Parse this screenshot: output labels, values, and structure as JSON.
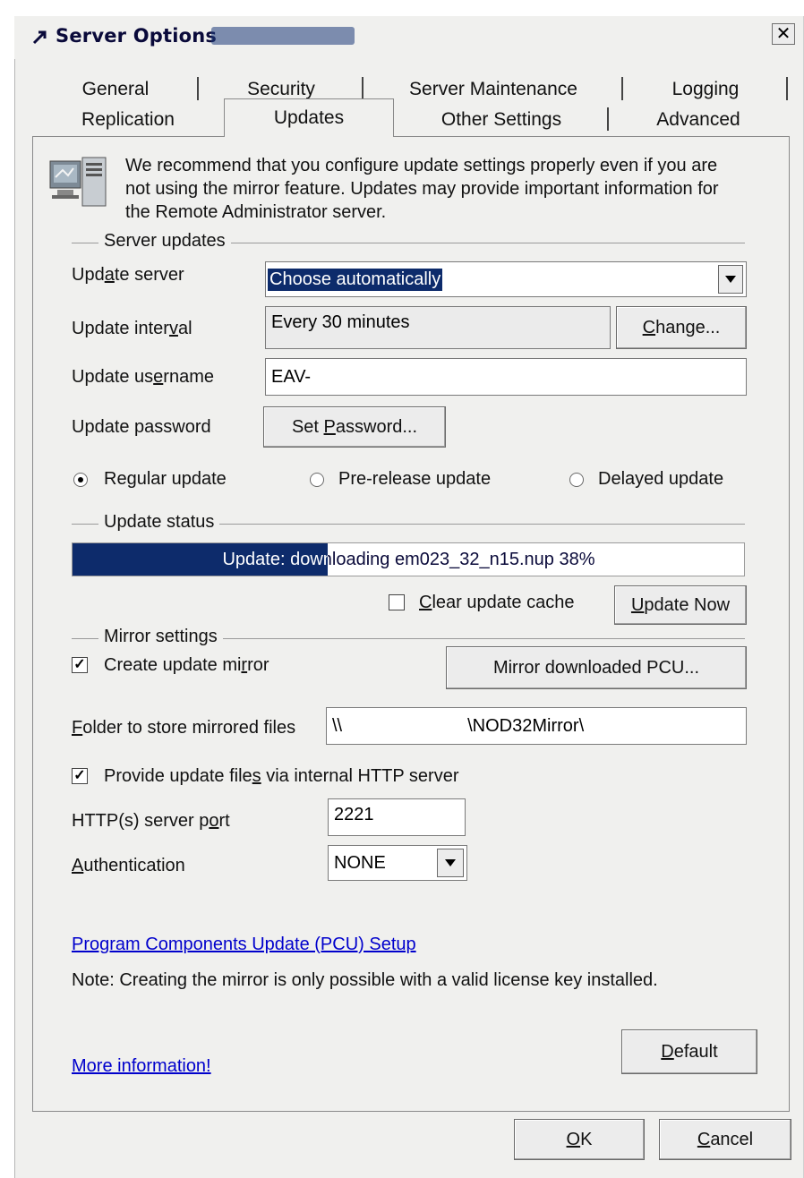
{
  "window": {
    "title": "Server Options"
  },
  "tabs_row1": [
    {
      "label": "General"
    },
    {
      "label": "Security"
    },
    {
      "label": "Server Maintenance"
    },
    {
      "label": "Logging"
    }
  ],
  "tabs_row2": [
    {
      "label": "Replication"
    },
    {
      "label": "Updates",
      "active": true
    },
    {
      "label": "Other Settings"
    },
    {
      "label": "Advanced"
    }
  ],
  "info": {
    "line1": "We recommend that you configure update settings properly even if you are",
    "line2": "not using the mirror feature. Updates may provide important information for",
    "line3": "the Remote Administrator server."
  },
  "server_updates": {
    "group_label": "Server updates",
    "update_server_label": "Update server",
    "update_server_value": "Choose automatically",
    "update_interval_label": "Update interval",
    "update_interval_value": "Every 30 minutes",
    "change_button": "Change...",
    "update_username_label": "Update username",
    "update_username_value": "EAV-",
    "update_password_label": "Update password",
    "set_password_button": "Set Password...",
    "radio_regular": "Regular update",
    "radio_prerelease": "Pre-release update",
    "radio_delayed": "Delayed update",
    "selected_radio": "regular"
  },
  "update_status": {
    "group_label": "Update status",
    "progress_text": "Update: downloading em023_32_n15.nup 38%",
    "progress_fraction": 0.38,
    "clear_cache_label": "Clear update cache",
    "clear_cache_checked": false,
    "update_now_button": "Update Now"
  },
  "mirror": {
    "group_label": "Mirror settings",
    "create_mirror_label": "Create update mirror",
    "create_mirror_checked": true,
    "mirror_pcu_button": "Mirror downloaded PCU...",
    "folder_label": "Folder to store mirrored files",
    "folder_value_prefix": "\\\\",
    "folder_value_suffix": "\\NOD32Mirror\\",
    "http_label": "Provide update files via internal HTTP server",
    "http_checked": true,
    "port_label": "HTTP(s) server port",
    "port_value": "2221",
    "auth_label": "Authentication",
    "auth_value": "NONE"
  },
  "footer": {
    "pcu_link": "Program Components Update (PCU) Setup",
    "note": "Note: Creating the mirror is only possible with a valid license key installed.",
    "more_info_link": "More information!",
    "default_button": "Default",
    "ok_button": "OK",
    "cancel_button": "Cancel"
  },
  "colors": {
    "progress_fill": "#0d2b6b",
    "link": "#0000cc",
    "selection": "#0d2b6b"
  }
}
